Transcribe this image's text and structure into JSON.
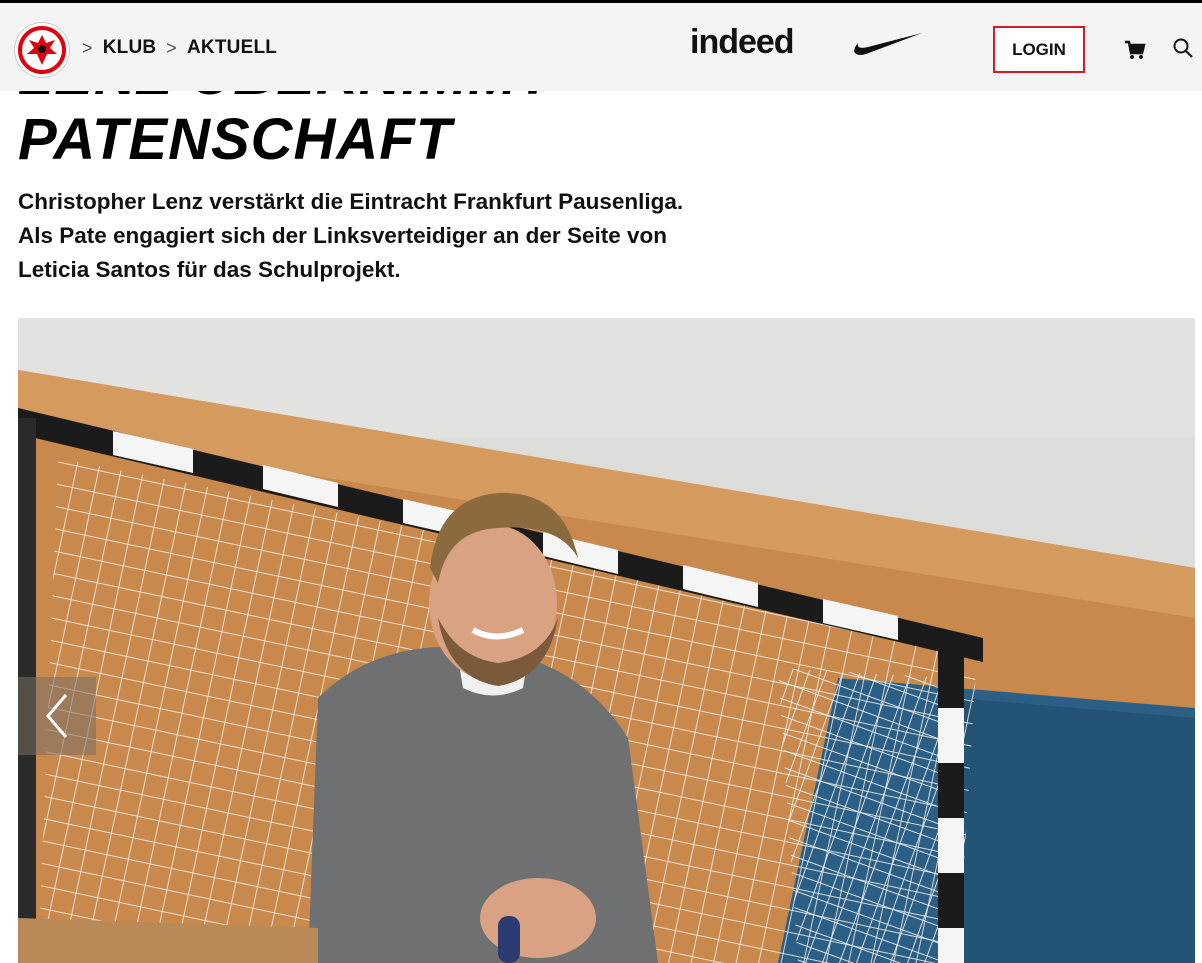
{
  "header": {
    "breadcrumb": [
      "KLUB",
      "AKTUELL"
    ],
    "sponsor_indeed": "indeed",
    "login_label": "LOGIN",
    "icons": [
      "eagle-crest-icon",
      "cart-icon",
      "search-icon",
      "nike-swoosh-icon"
    ],
    "accent_color": "#d51a2a"
  },
  "article": {
    "title_line_partial": "LENZ ÜBERNIMMT",
    "title_line": "PATENSCHAFT",
    "lead_lines": [
      "Christopher Lenz verstärkt die Eintracht Frankfurt Pausenliga.",
      "Als Pate engagiert sich der Linksverteidiger an der Seite von",
      "Leticia Santos für das Schulprojekt."
    ]
  },
  "gallery": {
    "prev_icon": "chevron-left-icon"
  }
}
